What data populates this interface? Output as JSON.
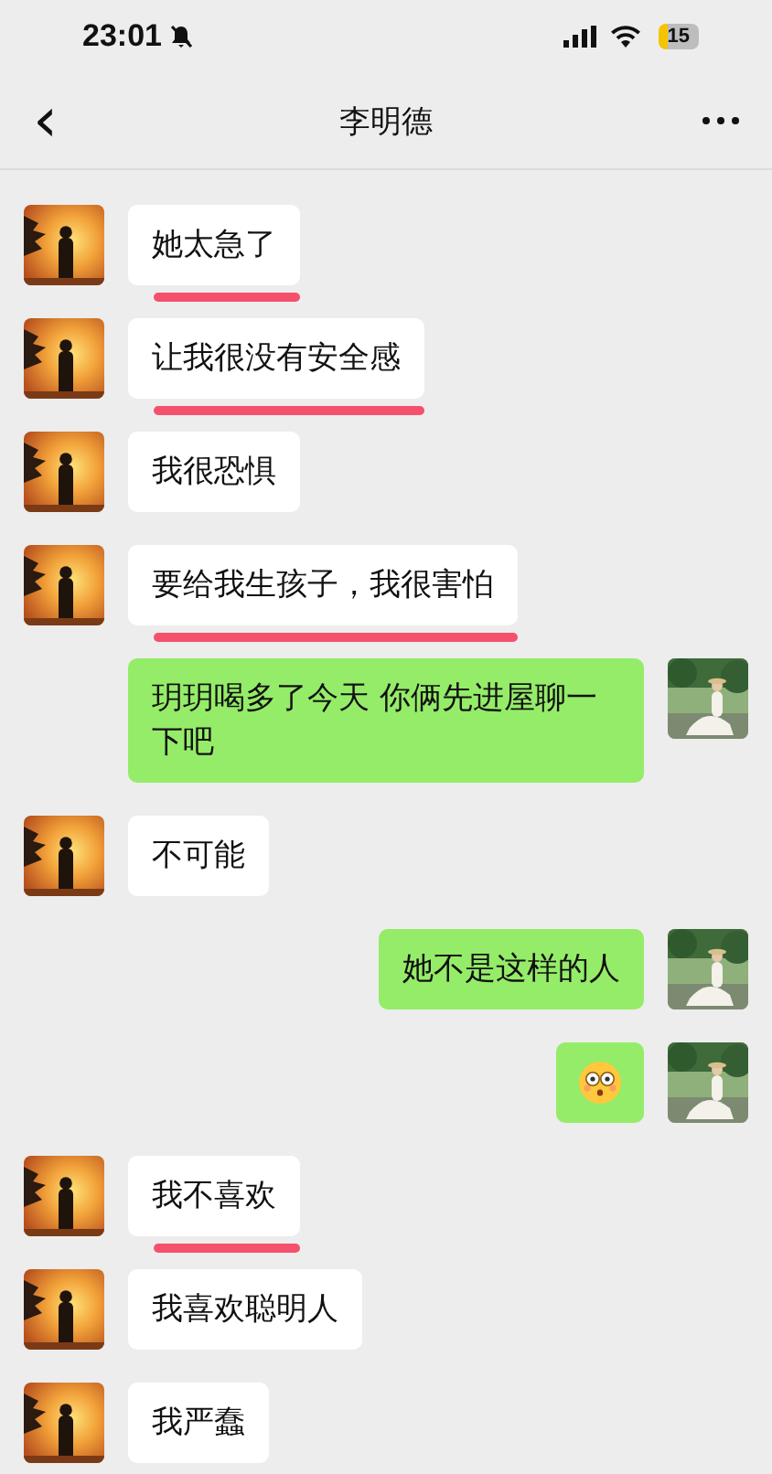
{
  "status_bar": {
    "time": "23:01",
    "silent": true,
    "battery": "15"
  },
  "nav": {
    "back": "‹",
    "title": "李明德"
  },
  "messages": [
    {
      "outgoing": false,
      "kind": "text",
      "text": "她太急了",
      "underlined": true
    },
    {
      "outgoing": false,
      "kind": "text",
      "text": "让我很没有安全感",
      "underlined": true
    },
    {
      "outgoing": false,
      "kind": "text",
      "text": "我很恐惧",
      "underlined": false
    },
    {
      "outgoing": false,
      "kind": "text",
      "text": "要给我生孩子，我很害怕",
      "underlined": true
    },
    {
      "outgoing": true,
      "kind": "text",
      "text": "玥玥喝多了今天 你俩先进屋聊一下吧",
      "underlined": false
    },
    {
      "outgoing": false,
      "kind": "text",
      "text": "不可能",
      "underlined": false
    },
    {
      "outgoing": true,
      "kind": "text",
      "text": "她不是这样的人",
      "underlined": false
    },
    {
      "outgoing": true,
      "kind": "emoji",
      "underlined": false
    },
    {
      "outgoing": false,
      "kind": "text",
      "text": "我不喜欢",
      "underlined": true
    },
    {
      "outgoing": false,
      "kind": "text",
      "text": "我喜欢聪明人",
      "underlined": false
    },
    {
      "outgoing": false,
      "kind": "text",
      "text": "我严蠢",
      "underlined": false
    }
  ]
}
